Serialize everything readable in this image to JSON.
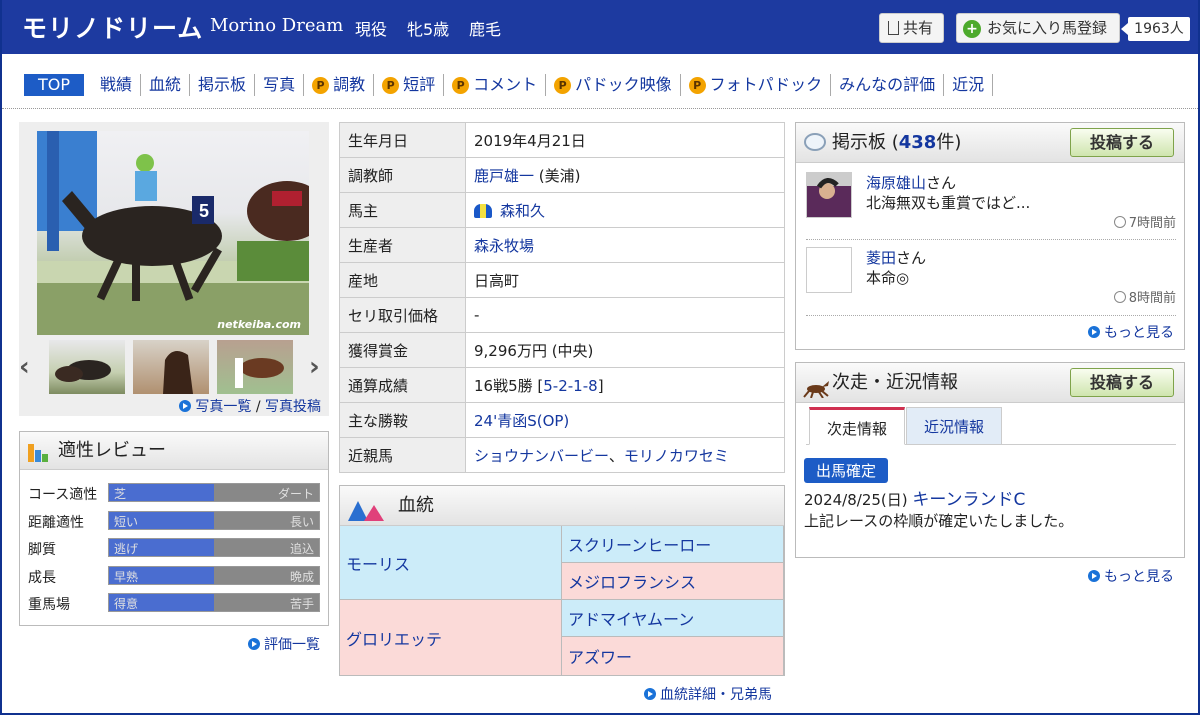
{
  "header": {
    "name": "モリノドリーム",
    "name_en": "Morino Dream",
    "status": "現役",
    "sex_age": "牝5歳",
    "coat": "鹿毛",
    "share_label": "共有",
    "favorite_label": "お気に入り馬登録",
    "favorite_count": "1963人"
  },
  "nav": {
    "top": "TOP",
    "items": [
      "戦績",
      "血統",
      "掲示板",
      "写真",
      "調教",
      "短評",
      "コメント",
      "パドック映像",
      "フォトパドック",
      "みんなの評価",
      "近況"
    ],
    "p_mark": "P"
  },
  "photo": {
    "watermark": "netkeiba.com",
    "links": {
      "list": "写真一覧",
      "sep": " / ",
      "post": "写真投稿"
    }
  },
  "fitness": {
    "title": "適性レビュー",
    "rows": [
      {
        "label": "コース適性",
        "left": "芝",
        "right": "ダート",
        "value": 0.5
      },
      {
        "label": "距離適性",
        "left": "短い",
        "right": "長い",
        "value": 0.5
      },
      {
        "label": "脚質",
        "left": "逃げ",
        "right": "追込",
        "value": 0.5
      },
      {
        "label": "成長",
        "left": "早熟",
        "right": "晩成",
        "value": 0.5
      },
      {
        "label": "重馬場",
        "left": "得意",
        "right": "苦手",
        "value": 0.5
      }
    ],
    "link": "評価一覧"
  },
  "profile": [
    {
      "k": "生年月日",
      "v": "2019年4月21日"
    },
    {
      "k": "調教師",
      "v": "鹿戸雄一",
      "v2": " (美浦)"
    },
    {
      "k": "馬主",
      "v": "森和久"
    },
    {
      "k": "生産者",
      "v": "森永牧場"
    },
    {
      "k": "産地",
      "v": "日高町"
    },
    {
      "k": "セリ取引価格",
      "v": "-"
    },
    {
      "k": "獲得賞金",
      "v": "9,296万円 (中央)"
    },
    {
      "k": "通算成績",
      "v": "16戦5勝 [",
      "v2": "5-2-1-8",
      "v3": "]"
    },
    {
      "k": "主な勝鞍",
      "v": "24'青函S(OP)"
    },
    {
      "k": "近親馬",
      "v": "ショウナンバービー",
      "v2": "、",
      "v3": "モリノカワセミ"
    }
  ],
  "pedigree": {
    "title": "血統",
    "sire": "モーリス",
    "dam": "グロリエッテ",
    "sire_sire": "スクリーンヒーロー",
    "sire_dam": "メジロフランシス",
    "dam_sire": "アドマイヤムーン",
    "dam_dam": "アズワー",
    "link": "血統詳細・兄弟馬"
  },
  "board": {
    "title": "掲示板 (",
    "count": "438",
    "title_end": "件)",
    "post_btn": "投稿する",
    "posts": [
      {
        "user": "海原雄山",
        "suffix": "さん",
        "comment": "北海無双も重賞ではど...",
        "time": "7時間前"
      },
      {
        "user": "菱田",
        "suffix": "さん",
        "comment": "本命◎",
        "time": "8時間前"
      }
    ],
    "more": "もっと見る"
  },
  "next": {
    "title": "次走・近況情報",
    "post_btn": "投稿する",
    "tabs": [
      "次走情報",
      "近況情報"
    ],
    "badge": "出馬確定",
    "date": "2024/8/25(日) ",
    "race": "キーンランドC",
    "text": "上記レースの枠順が確定いたしました。",
    "more": "もっと見る"
  }
}
